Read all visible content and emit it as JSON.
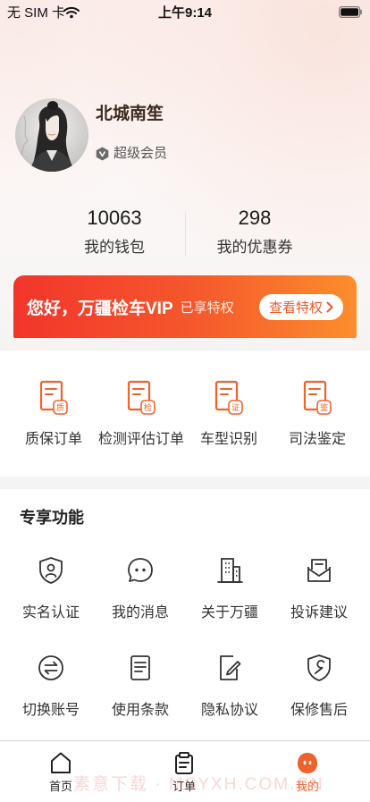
{
  "status_bar": {
    "carrier": "无 SIM 卡",
    "time": "上午9:14",
    "icons": [
      "wifi-icon",
      "battery-icon"
    ]
  },
  "profile": {
    "name": "北城南笙",
    "level": "超级会员",
    "level_icon": "member-badge-icon"
  },
  "stats": [
    {
      "value": "10063",
      "label": "我的钱包"
    },
    {
      "value": "298",
      "label": "我的优惠券"
    }
  ],
  "vip_banner": {
    "greeting": "您好，万疆检车VIP",
    "status": "已享特权",
    "button_label": "查看特权"
  },
  "orders": [
    {
      "label": "质保订单",
      "badge": "质",
      "icon": "warranty-document-icon"
    },
    {
      "label": "检测评估订单",
      "badge": "检",
      "icon": "inspection-document-icon"
    },
    {
      "label": "车型识别",
      "badge": "证",
      "icon": "model-document-icon"
    },
    {
      "label": "司法鉴定",
      "badge": "鉴",
      "icon": "appraisal-document-icon"
    }
  ],
  "features": {
    "title": "专享功能",
    "items": [
      {
        "label": "实名认证",
        "icon": "shield-user-icon"
      },
      {
        "label": "我的消息",
        "icon": "message-bubble-icon"
      },
      {
        "label": "关于万疆",
        "icon": "building-icon"
      },
      {
        "label": "投诉建议",
        "icon": "mail-document-icon"
      },
      {
        "label": "切换账号",
        "icon": "switch-account-icon"
      },
      {
        "label": "使用条款",
        "icon": "document-icon"
      },
      {
        "label": "隐私协议",
        "icon": "document-edit-icon"
      },
      {
        "label": "保修售后",
        "icon": "shield-wrench-icon"
      }
    ]
  },
  "tab_bar": {
    "items": [
      {
        "label": "首页",
        "icon": "home-icon",
        "active": false
      },
      {
        "label": "订单",
        "icon": "clipboard-icon",
        "active": false
      },
      {
        "label": "我的",
        "icon": "mine-face-icon",
        "active": true
      }
    ]
  },
  "watermark": "素意下载 · MSYXH.COM.CN",
  "colors": {
    "accent": "#f0622b",
    "banner_start": "#f2352b",
    "banner_end": "#fc8e2c",
    "name_text": "#3b2a1c",
    "body_text": "#333333"
  }
}
